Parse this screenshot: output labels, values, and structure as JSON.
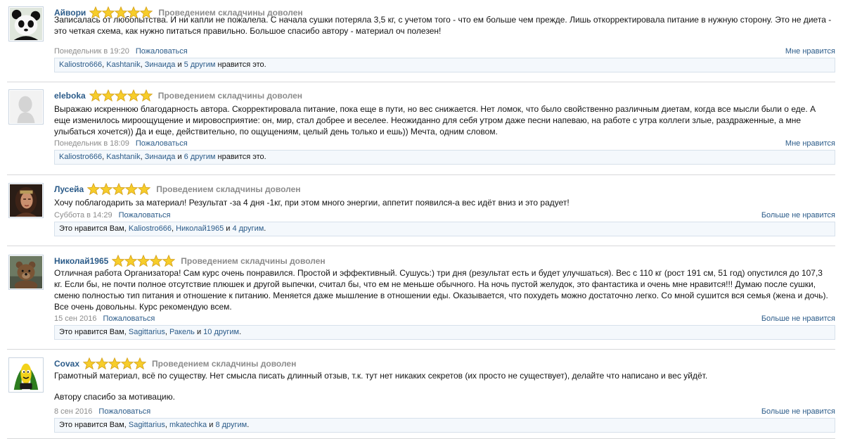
{
  "reviews": [
    {
      "author": "Айвори",
      "avatar": "panda-avatar",
      "rating": 5,
      "title": "Проведением складчины доволен",
      "paragraphs": [
        "Записалась от любопытства. И ни капли не пожалела. С начала сушки потеряла 3,5 кг, с учетом того - что ем больше чем прежде. Лишь откорректировала питание в нужную сторону. Это не диета - это четкая схема, как нужно питаться правильно. Большое спасибо автору - материал оч полезен!"
      ],
      "date": "Понедельник в 19:20",
      "report_label": "Пожаловаться",
      "like_label": "Мне нравится",
      "likes": {
        "prefix": "",
        "users": [
          "Kaliostro666",
          "Kashtanik",
          "Зинаида"
        ],
        "and": " и ",
        "others": "5 другим",
        "suffix": " нравится это."
      }
    },
    {
      "author": "eleboka",
      "avatar": "default-silhouette-avatar",
      "rating": 5,
      "title": "Проведением складчины доволен",
      "paragraphs": [
        "Выражаю искреннюю благодарность автора. Скорректировала питание, пока еще в пути, но вес снижается. Нет ломок, что было свойственно различным диетам, когда все мысли были о еде. А еще изменилось мироощущение и мировосприятие: он, мир, стал добрее и веселее. Неожиданно для себя утром даже песни напеваю, на работе с утра коллеги злые, раздраженные, а мне улыбаться хочется)) Да и еще, действительно, по ощущениям, целый день только и ешь)) Мечта, одним словом."
      ],
      "date": "Понедельник в 18:09",
      "report_label": "Пожаловаться",
      "like_label": "Мне нравится",
      "likes": {
        "prefix": "",
        "users": [
          "Kaliostro666",
          "Kashtanik",
          "Зинаида"
        ],
        "and": " и ",
        "others": "6 другим",
        "suffix": " нравится это."
      }
    },
    {
      "author": "Лусейа",
      "avatar": "woman-portrait-avatar",
      "rating": 5,
      "title": "Проведением складчины доволен",
      "paragraphs": [
        "Хочу поблагодарить за материал! Результат -за 4 дня -1кг, при этом много энергии, аппетит появился-а вес идёт вниз и это радует!"
      ],
      "date": "Суббота в 14:29",
      "report_label": "Пожаловаться",
      "like_label": "Больше не нравится",
      "likes": {
        "prefix": "Это нравится Вам, ",
        "users": [
          "Kaliostro666",
          "Николай1965"
        ],
        "and": " и ",
        "others": "4 другим",
        "suffix": "."
      }
    },
    {
      "author": "Николай1965",
      "avatar": "bear-avatar",
      "rating": 5,
      "title": "Проведением складчины доволен",
      "paragraphs": [
        "Отличная работа Организатора! Сам курс очень понравился. Простой и эффективный. Сушусь:) три дня (результат есть и будет улучшаться). Вес с 110 кг (рост 191 см, 51 год) опустился до 107,3 кг. Если бы, не почти полное отсутствие плюшек и другой выпечки, считал бы, что ем не меньше обычного. На ночь пустой желудок, это фантастика и очень мне нравится!!! Думаю после сушки, сменю полностью тип питания и отношение к питанию. Меняется даже мышление в отношении еды. Оказывается, что похудеть можно достаточно легко. Со мной сушится вся семья (жена и дочь). Все очень довольны. Курс рекомендую всем."
      ],
      "date": "15 сен 2016",
      "report_label": "Пожаловаться",
      "like_label": "Больше не нравится",
      "likes": {
        "prefix": "Это нравится Вам, ",
        "users": [
          "Sagittarius",
          "Ракель"
        ],
        "and": " и ",
        "others": "10 другим",
        "suffix": "."
      }
    },
    {
      "author": "Covax",
      "avatar": "corn-character-avatar",
      "rating": 5,
      "title": "Проведением складчины доволен",
      "paragraphs": [
        "Грамотный материал, всё по существу. Нет смысла писать длинный отзыв, т.к. тут нет никаких секретов (их просто не существует), делайте что написано и вес уйдёт.",
        "Автору спасибо за мотивацию."
      ],
      "date": "8 сен 2016",
      "report_label": "Пожаловаться",
      "like_label": "Больше не нравится",
      "likes": {
        "prefix": "Это нравится Вам, ",
        "users": [
          "Sagittarius",
          "mkatechka"
        ],
        "and": " и ",
        "others": "8 другим",
        "suffix": "."
      }
    }
  ]
}
